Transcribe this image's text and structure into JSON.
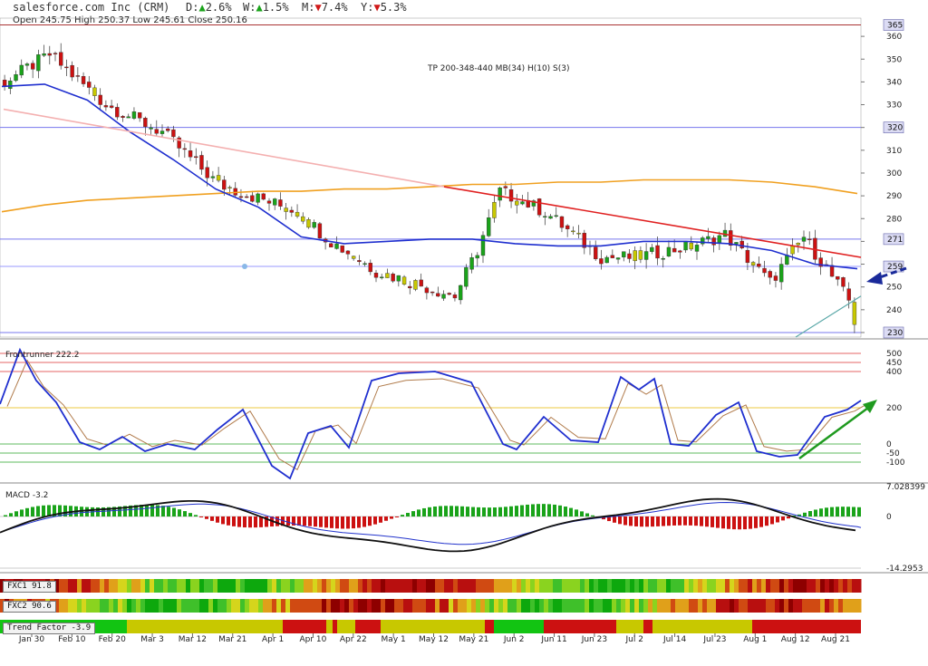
{
  "header": {
    "title": "salesforce.com Inc (CRM)",
    "changes": [
      {
        "label": "D:",
        "dir": "up",
        "value": "2.6%"
      },
      {
        "label": "W:",
        "dir": "up",
        "value": "1.5%"
      },
      {
        "label": "M:",
        "dir": "down",
        "value": "7.4%"
      },
      {
        "label": "Y:",
        "dir": "down",
        "value": "5.3%"
      }
    ],
    "ohlc": "Open 245.75  High 250.37  Low 245.61  Close 250.16"
  },
  "price_panel": {
    "annotation": "TP 200-348-440 MB(34) H(10) S(3)",
    "y_ticks": [
      "360",
      "350",
      "340",
      "330",
      "320",
      "310",
      "300",
      "290",
      "280",
      "270",
      "260",
      "250",
      "240",
      "230"
    ],
    "highlighted_levels": [
      "365",
      "320",
      "271",
      "259",
      "230"
    ]
  },
  "frontrunner_panel": {
    "label": "Frontrunner 222.2",
    "y_ticks": [
      "500",
      "450",
      "400",
      "200",
      "0",
      "-50",
      "-100"
    ]
  },
  "macd_panel": {
    "label": "MACD -3.2",
    "y_ticks": [
      "7.028399",
      "0",
      "-14.2953"
    ]
  },
  "bands": [
    {
      "label": "FXC1  91.8"
    },
    {
      "label": "FXC2  90.6"
    },
    {
      "label": "Trend Factor -3.9"
    }
  ],
  "x_labels": [
    "Jan 30",
    "Feb 10",
    "Feb 20",
    "Mar 3",
    "Mar 12",
    "Mar 21",
    "Apr 1",
    "Apr 10",
    "Apr 22",
    "May 1",
    "May 12",
    "May 21",
    "Jun 2",
    "Jun 11",
    "Jun 23",
    "Jul 2",
    "Jul 14",
    "Jul 23",
    "Aug 1",
    "Aug 12",
    "Aug 21"
  ],
  "colors": {
    "up": "#1aa31a",
    "down": "#cc1111",
    "neutral": "#c8c800",
    "ma34": "#1f2fcf",
    "ma200": "#f0a020",
    "trend_down": "#e02020",
    "trend_light": "#f4b0b0",
    "signal_arrow": "#1a2a9a",
    "green_arrow": "#1f9a1f"
  },
  "chart_data": {
    "type": "candlestick",
    "title": "salesforce.com Inc (CRM)",
    "x": [
      "Jan 30",
      "Feb 10",
      "Feb 20",
      "Mar 3",
      "Mar 12",
      "Mar 21",
      "Apr 1",
      "Apr 10",
      "Apr 22",
      "May 1",
      "May 12",
      "May 21",
      "Jun 2",
      "Jun 11",
      "Jun 23",
      "Jul 2",
      "Jul 14",
      "Jul 23",
      "Aug 1",
      "Aug 12",
      "Aug 21"
    ],
    "close_approx": [
      350,
      327,
      305,
      290,
      277,
      279,
      258,
      259,
      246,
      268,
      290,
      277,
      264,
      266,
      270,
      274,
      256,
      270,
      245,
      236,
      250
    ],
    "ma34_approx": [
      338,
      339,
      332,
      318,
      306,
      293,
      285,
      272,
      269,
      270,
      271,
      271,
      269,
      268,
      268,
      270,
      270,
      269,
      266,
      260,
      258
    ],
    "ma200_approx": [
      283,
      286,
      288,
      289,
      290,
      291,
      292,
      292,
      293,
      293,
      294,
      295,
      295,
      296,
      296,
      297,
      297,
      297,
      296,
      294,
      291
    ],
    "ylim": [
      228,
      368
    ]
  }
}
